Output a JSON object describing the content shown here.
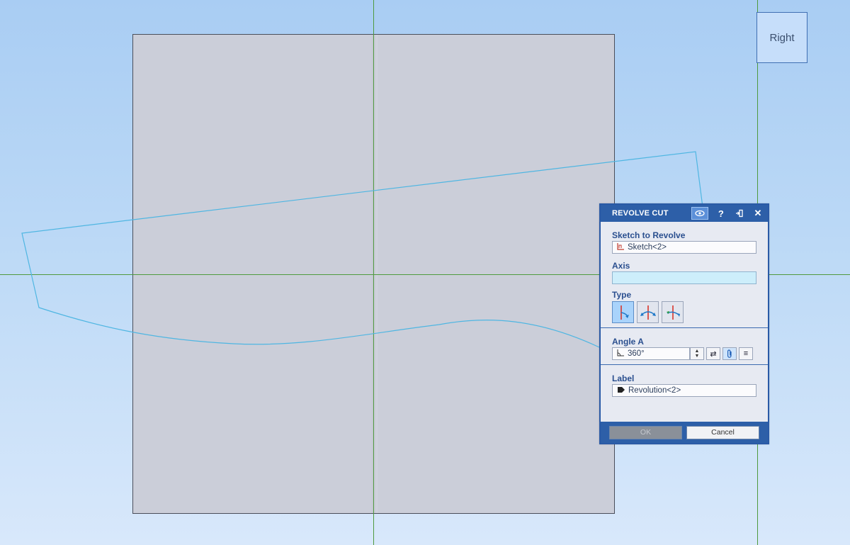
{
  "viewcube": {
    "face_label": "Right"
  },
  "dialog": {
    "title": "REVOLVE CUT",
    "header_icons": [
      "preview-eye-icon",
      "help-icon",
      "pin-icon",
      "close-icon"
    ],
    "sketch_section": {
      "label": "Sketch to Revolve",
      "value": "Sketch<2>",
      "icon": "sketch-icon"
    },
    "axis_section": {
      "label": "Axis",
      "value": ""
    },
    "type_section": {
      "label": "Type",
      "options": [
        "one-direction",
        "two-directions",
        "symmetric"
      ],
      "selected": "one-direction"
    },
    "angle_section": {
      "label": "Angle A",
      "value": "360°",
      "icon": "angle-icon"
    },
    "label_section": {
      "label": "Label",
      "value": "Revolution<2>",
      "icon": "tag-icon"
    },
    "buttons": {
      "ok": "OK",
      "cancel": "Cancel"
    }
  },
  "colors": {
    "background_top": "#a9cdf3",
    "background_bottom": "#d8e8fb",
    "part_face": "#cbced9",
    "axis_line": "#4f9a3e",
    "sketch_line": "#4fb6e2",
    "dialog_header": "#2d5fa8"
  }
}
